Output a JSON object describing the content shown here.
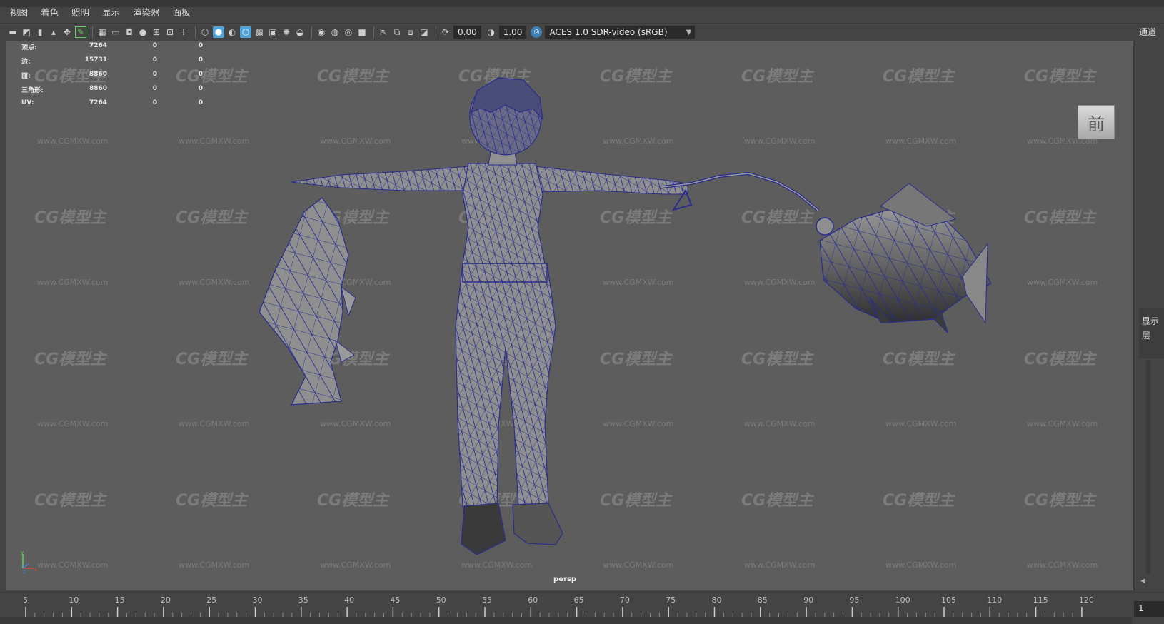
{
  "menu": [
    "视图",
    "着色",
    "照明",
    "显示",
    "渲染器",
    "面板"
  ],
  "toolbar": {
    "icons": [
      "select-camera-icon",
      "camera-attributes-icon",
      "bookmark-icon",
      "image-plane-icon",
      "2d-pan-icon",
      "grease-pencil-icon",
      "grid-icon",
      "film-gate-icon",
      "resolution-gate-icon",
      "gate-mask-icon",
      "field-chart-icon",
      "safe-action-icon",
      "safe-title-icon",
      "wireframe-icon",
      "smooth-shade-icon",
      "use-default-material-icon",
      "wireframe-on-shaded-icon",
      "xray-icon",
      "textured-icon",
      "use-all-lights-icon",
      "shadows-icon",
      "screen-space-ao-icon",
      "motion-blur-icon",
      "multisample-aa-icon",
      "depth-of-field-icon",
      "isolate-select-icon",
      "xray-joints-icon",
      "xray-active-icon",
      "backface-culling-icon"
    ],
    "exposure": "0.00",
    "gamma": "1.00",
    "color_space": "ACES 1.0 SDR-video (sRGB)"
  },
  "hud": [
    {
      "label": "顶点:",
      "v1": "7264",
      "v2": "0",
      "v3": "0"
    },
    {
      "label": "边:",
      "v1": "15731",
      "v2": "0",
      "v3": "0"
    },
    {
      "label": "面:",
      "v1": "8860",
      "v2": "0",
      "v3": "0"
    },
    {
      "label": "三角形:",
      "v1": "8860",
      "v2": "0",
      "v3": "0"
    },
    {
      "label": "UV:",
      "v1": "7264",
      "v2": "0",
      "v3": "0"
    }
  ],
  "watermark": {
    "logo": "CG模型主",
    "url": "www.CGMXW.com"
  },
  "view_cube_label": "前",
  "camera_label": "persp",
  "right_panel": {
    "channels": "通道",
    "display": "显示",
    "layers": "层"
  },
  "timeline": {
    "labels": [
      "5",
      "10",
      "15",
      "20",
      "25",
      "30",
      "35",
      "40",
      "45",
      "50",
      "55",
      "60",
      "65",
      "70",
      "75",
      "80",
      "85",
      "90",
      "95",
      "100",
      "105",
      "110",
      "115",
      "120"
    ],
    "current_frame": "1"
  },
  "colors": {
    "wire": "#2a2d8c",
    "mesh": "#8f8f8f",
    "viewport_bg": "#5d5d5d",
    "accent": "#4fa1d6"
  }
}
